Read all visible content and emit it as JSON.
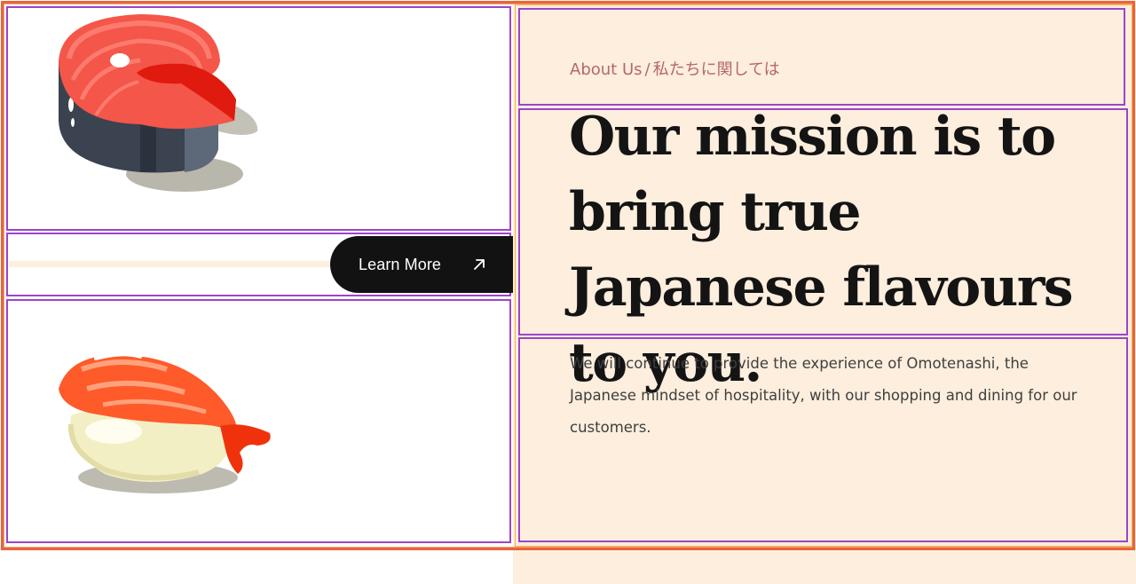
{
  "about": {
    "eyebrow_en": "About Us",
    "eyebrow_sep": "/",
    "eyebrow_jp": "私たちに関しては",
    "headline": "Our mission is to bring true Japanese flavours to you.",
    "body": "We will continue to provide the experience of Omotenashi, the Japanese mindset of hospitality, with our shopping and dining for our customers."
  },
  "cta": {
    "label": "Learn More",
    "icon": "arrow-up-right-icon"
  },
  "images": {
    "top": "salmon-steak-illustration",
    "bottom": "shrimp-nigiri-illustration"
  },
  "colors": {
    "cream": "#fdeedd",
    "dark": "#121212",
    "accent": "#b5676b",
    "frame_orange": "#e8643c",
    "frame_purple": "#9b45c9"
  }
}
